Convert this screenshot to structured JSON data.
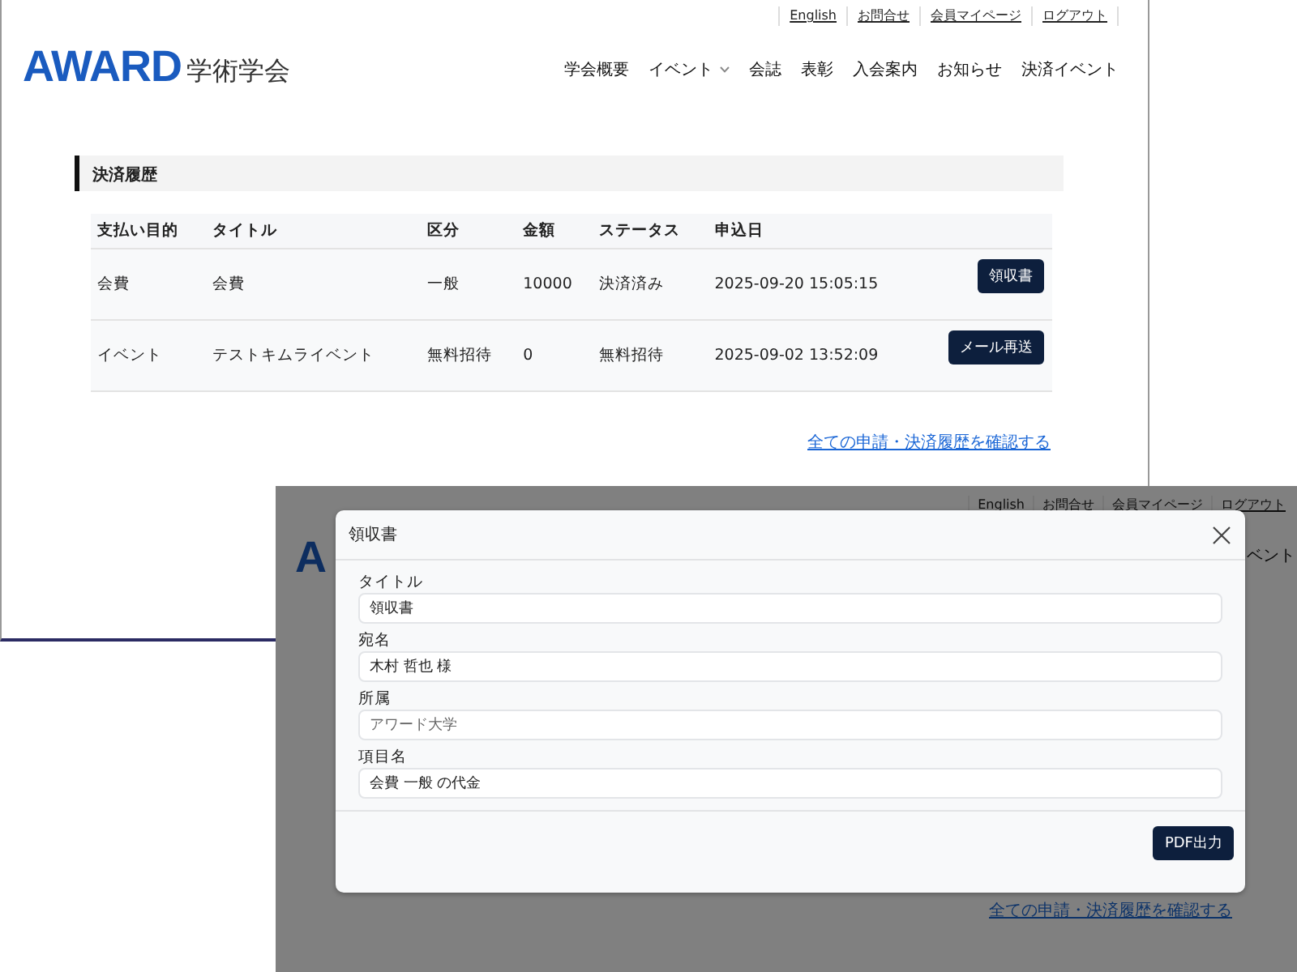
{
  "page": {
    "top_links": [
      "English",
      "お問合せ",
      "会員マイページ",
      "ログアウト"
    ],
    "logo": {
      "mark": "AWARD",
      "name": "学術学会"
    },
    "nav": [
      {
        "label": "学会概要",
        "dropdown": false
      },
      {
        "label": "イベント",
        "dropdown": true
      },
      {
        "label": "会誌",
        "dropdown": false
      },
      {
        "label": "表彰",
        "dropdown": false
      },
      {
        "label": "入会案内",
        "dropdown": false
      },
      {
        "label": "お知らせ",
        "dropdown": false
      },
      {
        "label": "決済イベント",
        "dropdown": false
      }
    ],
    "section_title": "決済履歴",
    "table": {
      "columns": [
        "支払い目的",
        "タイトル",
        "区分",
        "金額",
        "ステータス",
        "申込日"
      ],
      "rows": [
        {
          "cells": [
            "会費",
            "会費",
            "一般",
            "10000",
            "決済済み",
            "2025-09-20 15:05:15"
          ],
          "action": "領収書"
        },
        {
          "cells": [
            "イベント",
            "テストキムライベント",
            "無料招待",
            "0",
            "無料招待",
            "2025-09-02 13:52:09"
          ],
          "action": "メール再送"
        }
      ]
    },
    "history_link": "全ての申請・決済履歴を確認する"
  },
  "dimmed_page": {
    "top_links": [
      "English",
      "お問合せ",
      "会員マイページ",
      "ログアウト"
    ],
    "logo_fragment": "A",
    "nav_fragment": "ベント",
    "history_link": "全ての申請・決済履歴を確認する",
    "modal": {
      "title": "領収書",
      "fields": [
        {
          "label": "タイトル",
          "value": "領収書"
        },
        {
          "label": "宛名",
          "value": "木村 哲也 様"
        },
        {
          "label": "所属",
          "placeholder": "アワード大学"
        },
        {
          "label": "項目名",
          "value": "会費 一般 の代金"
        }
      ],
      "button": "PDF出力"
    }
  }
}
